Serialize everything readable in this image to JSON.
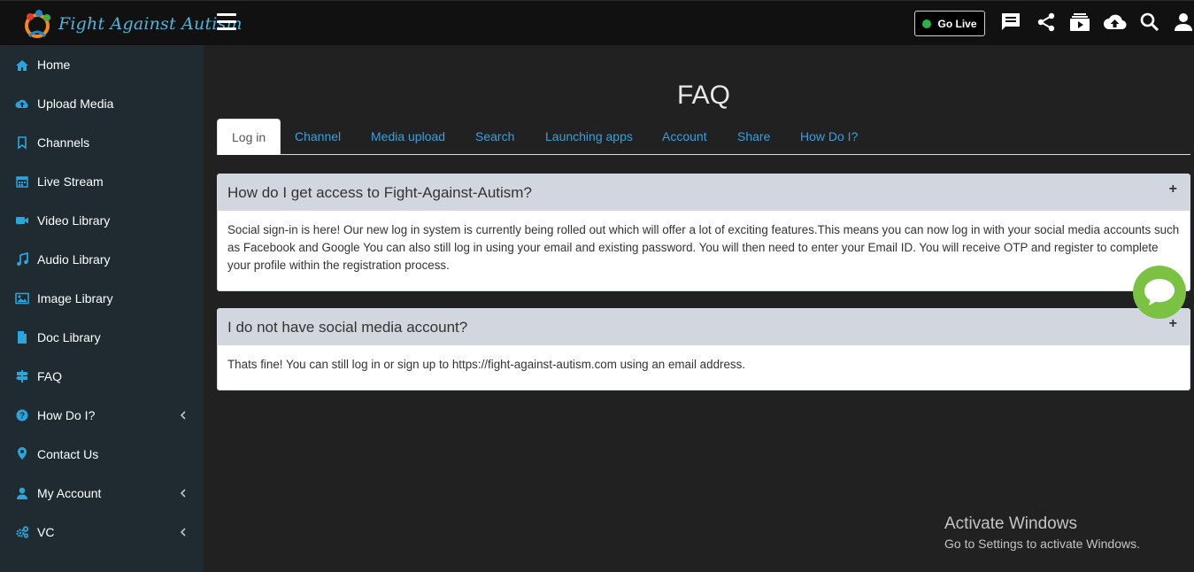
{
  "app": {
    "logo_text": "Fight Against Autism"
  },
  "topbar": {
    "go_live_label": "Go Live"
  },
  "sidebar": {
    "items": [
      {
        "label": "Home",
        "icon": "home-icon",
        "expandable": false
      },
      {
        "label": "Upload Media",
        "icon": "cloud-upload-icon",
        "expandable": false
      },
      {
        "label": "Channels",
        "icon": "bookmark-icon",
        "expandable": false
      },
      {
        "label": "Live Stream",
        "icon": "calendar-icon",
        "expandable": false
      },
      {
        "label": "Video Library",
        "icon": "video-camera-icon",
        "expandable": false
      },
      {
        "label": "Audio Library",
        "icon": "music-note-icon",
        "expandable": false
      },
      {
        "label": "Image Library",
        "icon": "image-icon",
        "expandable": false
      },
      {
        "label": "Doc Library",
        "icon": "document-icon",
        "expandable": false
      },
      {
        "label": "FAQ",
        "icon": "signpost-icon",
        "expandable": false
      },
      {
        "label": "How Do I?",
        "icon": "question-circle-icon",
        "expandable": true
      },
      {
        "label": "Contact Us",
        "icon": "map-marker-icon",
        "expandable": false
      },
      {
        "label": "My Account",
        "icon": "user-icon",
        "expandable": true
      },
      {
        "label": "VC",
        "icon": "cogs-icon",
        "expandable": true
      }
    ]
  },
  "main": {
    "title": "FAQ",
    "tabs": [
      {
        "label": "Log in",
        "active": true
      },
      {
        "label": "Channel",
        "active": false
      },
      {
        "label": "Media upload",
        "active": false
      },
      {
        "label": "Search",
        "active": false
      },
      {
        "label": "Launching apps",
        "active": false
      },
      {
        "label": "Account",
        "active": false
      },
      {
        "label": "Share",
        "active": false
      },
      {
        "label": "How Do I?",
        "active": false
      }
    ],
    "faqs": [
      {
        "question": "How do I get access to Fight-Against-Autism?",
        "answer": "Social sign-in is here! Our new log in system is currently being rolled out which will offer a lot of exciting features.This means you can now log in with your social media accounts such as Facebook and Google You can also still log in using your email and existing password. You will then need to enter your Email ID. You will receive OTP and register to complete your profile within the registration process."
      },
      {
        "question": "I do not have social media account?",
        "answer": "Thats fine! You can still log in or sign up to https://fight-against-autism.com using an email address."
      }
    ],
    "expand_symbol": "+"
  },
  "watermark": {
    "line1": "Activate Windows",
    "line2": "Go to Settings to activate Windows."
  },
  "colors": {
    "topbar_bg": "#111111",
    "sidebar_bg": "#1f2b30",
    "main_bg": "#212121",
    "accent_blue": "#2aa6df",
    "tab_link": "#3c9fd9",
    "panel_head_bg": "#d2d6de",
    "chat_green": "#7cc242",
    "live_dot": "#2bb34a"
  }
}
